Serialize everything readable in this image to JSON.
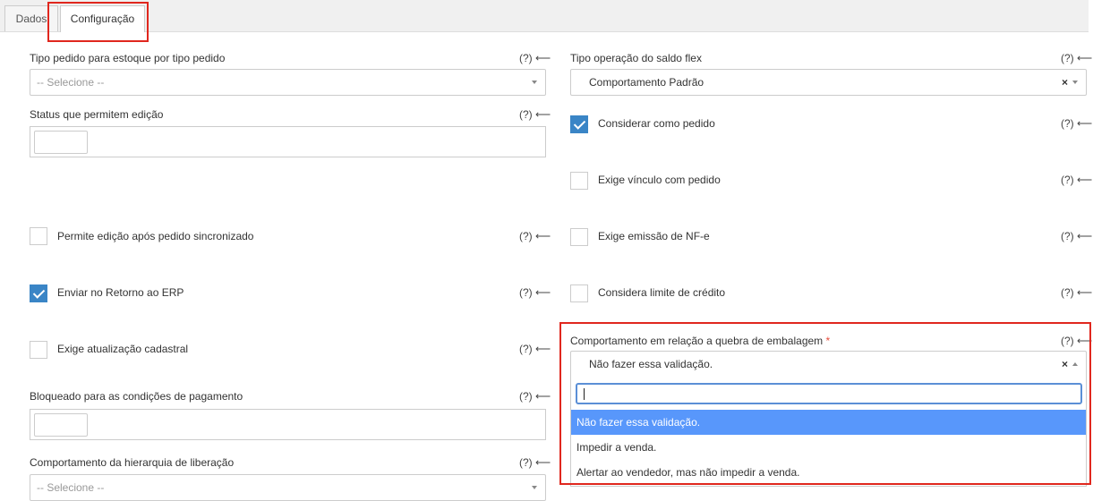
{
  "tabs": [
    {
      "label": "Dados"
    },
    {
      "label": "Configuração"
    }
  ],
  "help_text": "(?) ⟵",
  "left": {
    "tipo_pedido": {
      "label": "Tipo pedido para estoque por tipo pedido",
      "placeholder": "-- Selecione --"
    },
    "status_edicao": {
      "label": "Status que permitem edição"
    },
    "permite_edicao": {
      "label": "Permite edição após pedido sincronizado",
      "checked": false
    },
    "enviar_retorno": {
      "label": "Enviar no Retorno ao ERP",
      "checked": true
    },
    "exige_atualizacao": {
      "label": "Exige atualização cadastral",
      "checked": false
    },
    "bloqueado_condicoes": {
      "label": "Bloqueado para as condições de pagamento"
    },
    "hierarquia": {
      "label": "Comportamento da hierarquia de liberação",
      "placeholder": "-- Selecione --"
    }
  },
  "right": {
    "tipo_operacao": {
      "label": "Tipo operação do saldo flex",
      "value": "Comportamento Padrão"
    },
    "considerar_pedido": {
      "label": "Considerar como pedido",
      "checked": true
    },
    "exige_vinculo": {
      "label": "Exige vínculo com pedido",
      "checked": false
    },
    "exige_nfe": {
      "label": "Exige emissão de NF-e",
      "checked": false
    },
    "limite_credito": {
      "label": "Considera limite de crédito",
      "checked": false
    },
    "quebra_embalagem": {
      "label": "Comportamento em relação a quebra de embalagem",
      "required_mark": "*",
      "value": "Não fazer essa validação.",
      "search_value": "",
      "options": [
        "Não fazer essa validação.",
        "Impedir a venda.",
        "Alertar ao vendedor, mas não impedir a venda."
      ],
      "selected_index": 0
    }
  },
  "colors": {
    "highlight": "#e0271e",
    "checkbox_on": "#3a85c6",
    "option_selected": "#5897fb"
  }
}
